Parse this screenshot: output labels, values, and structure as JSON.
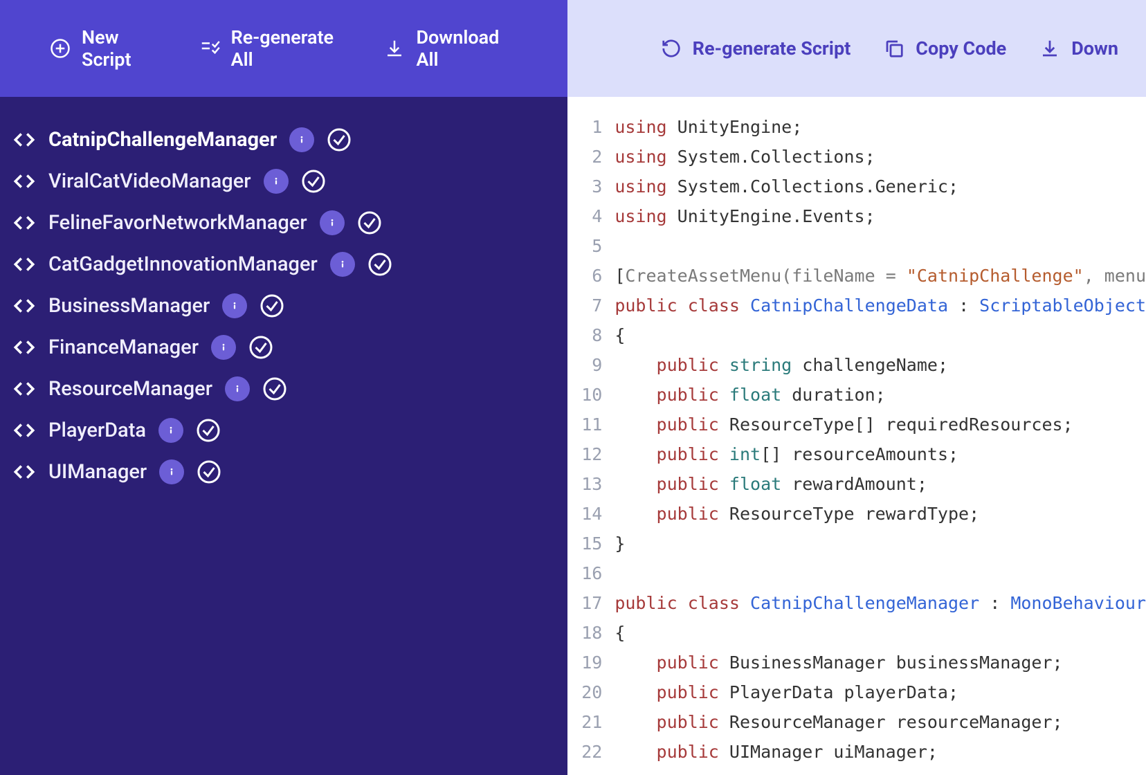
{
  "sidebar": {
    "buttons": {
      "new_script": "New Script",
      "regen_all": "Re-generate All",
      "download_all": "Download All"
    },
    "scripts": [
      {
        "name": "CatnipChallengeManager",
        "active": true
      },
      {
        "name": "ViralCatVideoManager",
        "active": false
      },
      {
        "name": "FelineFavorNetworkManager",
        "active": false
      },
      {
        "name": "CatGadgetInnovationManager",
        "active": false
      },
      {
        "name": "BusinessManager",
        "active": false
      },
      {
        "name": "FinanceManager",
        "active": false
      },
      {
        "name": "ResourceManager",
        "active": false
      },
      {
        "name": "PlayerData",
        "active": false
      },
      {
        "name": "UIManager",
        "active": false
      }
    ]
  },
  "main": {
    "buttons": {
      "regen_script": "Re-generate Script",
      "copy_code": "Copy Code",
      "download": "Down"
    }
  },
  "code": {
    "lines": [
      [
        [
          "k",
          "using"
        ],
        [
          "p",
          " UnityEngine;"
        ]
      ],
      [
        [
          "k",
          "using"
        ],
        [
          "p",
          " System.Collections;"
        ]
      ],
      [
        [
          "k",
          "using"
        ],
        [
          "p",
          " System.Collections.Generic;"
        ]
      ],
      [
        [
          "k",
          "using"
        ],
        [
          "p",
          " UnityEngine.Events;"
        ]
      ],
      [],
      [
        [
          "p",
          "["
        ],
        [
          "a",
          "CreateAssetMenu"
        ],
        [
          "a",
          "("
        ],
        [
          "a",
          "fileName = "
        ],
        [
          "s",
          "\"CatnipChallenge\""
        ],
        [
          "a",
          ", menu"
        ]
      ],
      [
        [
          "k",
          "public"
        ],
        [
          "p",
          " "
        ],
        [
          "k",
          "class"
        ],
        [
          "p",
          " "
        ],
        [
          "c",
          "CatnipChallengeData"
        ],
        [
          "p",
          " : "
        ],
        [
          "c",
          "ScriptableObject"
        ]
      ],
      [
        [
          "p",
          "{"
        ]
      ],
      [
        [
          "p",
          "    "
        ],
        [
          "k",
          "public"
        ],
        [
          "p",
          " "
        ],
        [
          "t",
          "string"
        ],
        [
          "p",
          " challengeName;"
        ]
      ],
      [
        [
          "p",
          "    "
        ],
        [
          "k",
          "public"
        ],
        [
          "p",
          " "
        ],
        [
          "t",
          "float"
        ],
        [
          "p",
          " duration;"
        ]
      ],
      [
        [
          "p",
          "    "
        ],
        [
          "k",
          "public"
        ],
        [
          "p",
          " ResourceType[] requiredResources;"
        ]
      ],
      [
        [
          "p",
          "    "
        ],
        [
          "k",
          "public"
        ],
        [
          "p",
          " "
        ],
        [
          "t",
          "int"
        ],
        [
          "p",
          "[] resourceAmounts;"
        ]
      ],
      [
        [
          "p",
          "    "
        ],
        [
          "k",
          "public"
        ],
        [
          "p",
          " "
        ],
        [
          "t",
          "float"
        ],
        [
          "p",
          " rewardAmount;"
        ]
      ],
      [
        [
          "p",
          "    "
        ],
        [
          "k",
          "public"
        ],
        [
          "p",
          " ResourceType rewardType;"
        ]
      ],
      [
        [
          "p",
          "}"
        ]
      ],
      [],
      [
        [
          "k",
          "public"
        ],
        [
          "p",
          " "
        ],
        [
          "k",
          "class"
        ],
        [
          "p",
          " "
        ],
        [
          "c",
          "CatnipChallengeManager"
        ],
        [
          "p",
          " : "
        ],
        [
          "c",
          "MonoBehaviour"
        ]
      ],
      [
        [
          "p",
          "{"
        ]
      ],
      [
        [
          "p",
          "    "
        ],
        [
          "k",
          "public"
        ],
        [
          "p",
          " BusinessManager businessManager;"
        ]
      ],
      [
        [
          "p",
          "    "
        ],
        [
          "k",
          "public"
        ],
        [
          "p",
          " PlayerData playerData;"
        ]
      ],
      [
        [
          "p",
          "    "
        ],
        [
          "k",
          "public"
        ],
        [
          "p",
          " ResourceManager resourceManager;"
        ]
      ],
      [
        [
          "p",
          "    "
        ],
        [
          "k",
          "public"
        ],
        [
          "p",
          " UIManager uiManager;"
        ]
      ]
    ]
  }
}
